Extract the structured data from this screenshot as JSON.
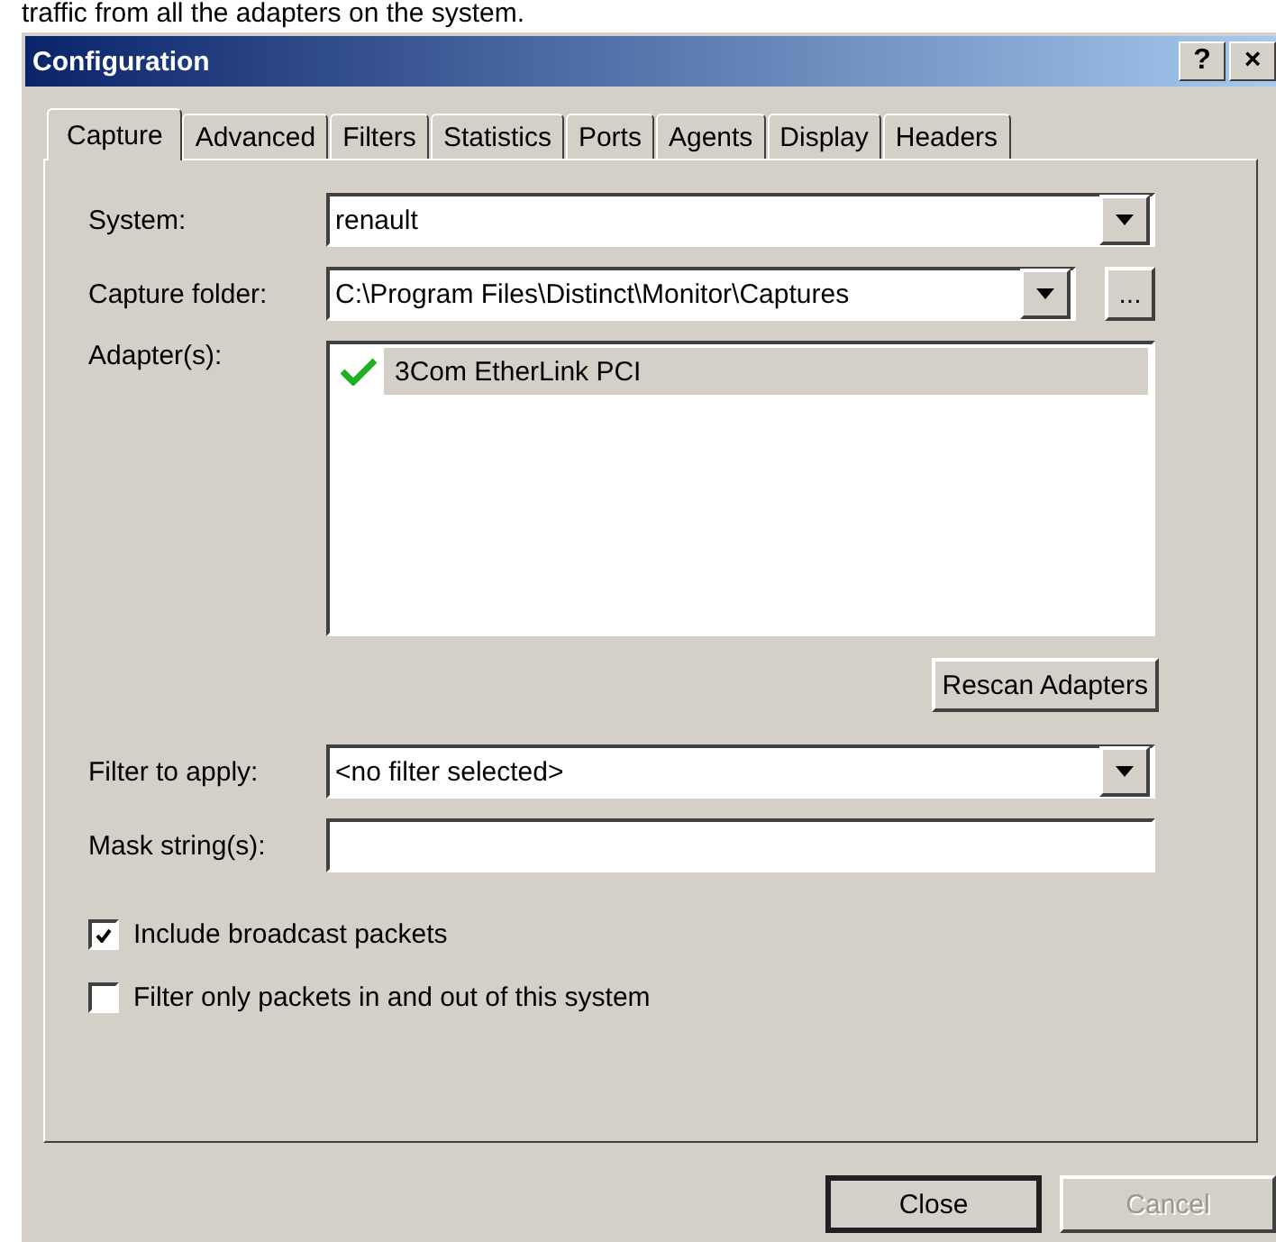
{
  "caption": "traffic from all the adapters on the system.",
  "window": {
    "title": "Configuration",
    "help_button": "?",
    "close_button": "×"
  },
  "tabs": [
    {
      "label": "Capture",
      "selected": true
    },
    {
      "label": "Advanced",
      "selected": false
    },
    {
      "label": "Filters",
      "selected": false
    },
    {
      "label": "Statistics",
      "selected": false
    },
    {
      "label": "Ports",
      "selected": false
    },
    {
      "label": "Agents",
      "selected": false
    },
    {
      "label": "Display",
      "selected": false
    },
    {
      "label": "Headers",
      "selected": false
    }
  ],
  "system": {
    "label": "System:",
    "value": "renault"
  },
  "capture_folder": {
    "label": "Capture folder:",
    "value": "C:\\Program Files\\Distinct\\Monitor\\Captures",
    "browse_button": "..."
  },
  "adapters": {
    "label": "Adapter(s):",
    "items": [
      {
        "name": "3Com EtherLink PCI",
        "checked": true,
        "selected": true
      }
    ]
  },
  "rescan_button": {
    "label": "Rescan Adapters"
  },
  "filter": {
    "label": "Filter to apply:",
    "value": "<no filter selected>"
  },
  "mask": {
    "label": "Mask string(s):"
  },
  "options": [
    {
      "label": "Include broadcast packets",
      "checked": true
    },
    {
      "label": "Filter only packets in and out of this system",
      "checked": false
    }
  ],
  "buttons": [
    {
      "label": "Close",
      "default": true,
      "disabled": false
    },
    {
      "label": "Cancel",
      "default": false,
      "disabled": true
    }
  ]
}
